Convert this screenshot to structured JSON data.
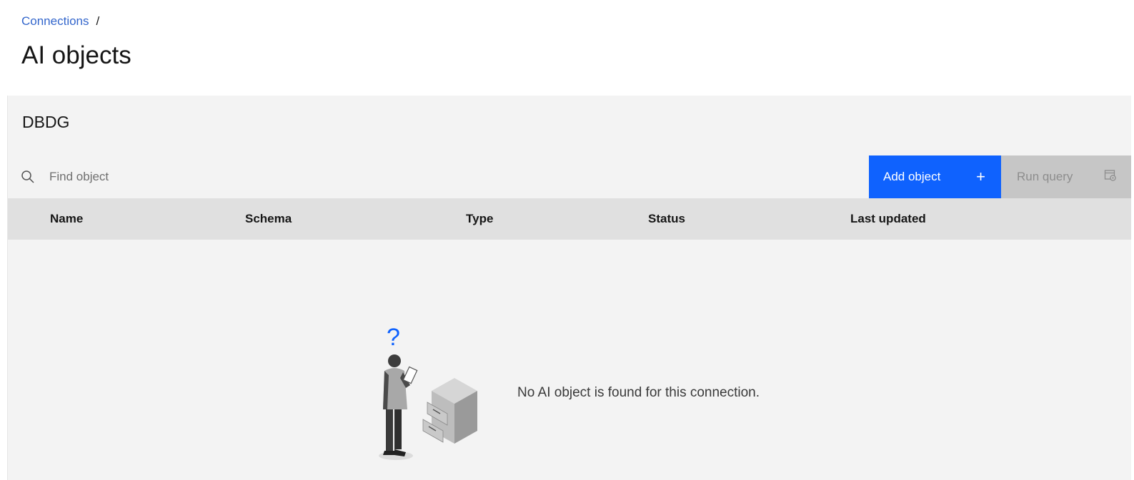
{
  "breadcrumb": {
    "parent": "Connections",
    "separator": "/"
  },
  "page": {
    "title": "AI objects"
  },
  "panel": {
    "title": "DBDG"
  },
  "search": {
    "placeholder": "Find object",
    "value": "",
    "icon": "search-icon"
  },
  "toolbar": {
    "add_label": "Add object",
    "add_icon": "+",
    "run_label": "Run query",
    "run_icon": "run-query-icon"
  },
  "table": {
    "columns": [
      "Name",
      "Schema",
      "Type",
      "Status",
      "Last updated"
    ],
    "rows": []
  },
  "empty_state": {
    "message": "No AI object is found for this connection.",
    "illustration": "person-with-question-mark-and-file-cabinet"
  },
  "colors": {
    "primary": "#0f62fe",
    "link": "#3366cc",
    "panel_bg": "#f3f3f3",
    "header_bg": "#e0e0e0",
    "disabled_bg": "#c6c6c6"
  }
}
